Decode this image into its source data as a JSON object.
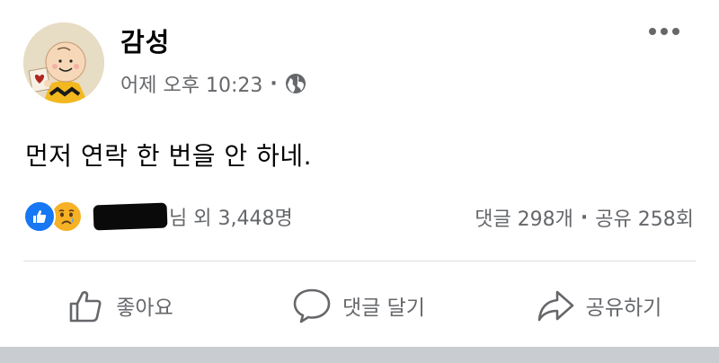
{
  "post": {
    "author": "감성",
    "timestamp": "어제 오후 10:23",
    "separator": "·",
    "privacy_icon": "globe-icon",
    "more_icon": "more-horizontal-icon",
    "text": "먼저 연락 한 번을 안 하네."
  },
  "reactions": {
    "icons": [
      "like-icon",
      "sad-icon"
    ],
    "names_suffix": "님 외 3,448명",
    "comments": "댓글 298개",
    "separator": "·",
    "shares": "공유 258회"
  },
  "actions": {
    "like": "좋아요",
    "comment": "댓글 달기",
    "share": "공유하기"
  },
  "colors": {
    "like_blue": "#1877f2",
    "sad_yellow": "#f7b125",
    "secondary_text": "#65676b",
    "divider": "#dadde1"
  }
}
